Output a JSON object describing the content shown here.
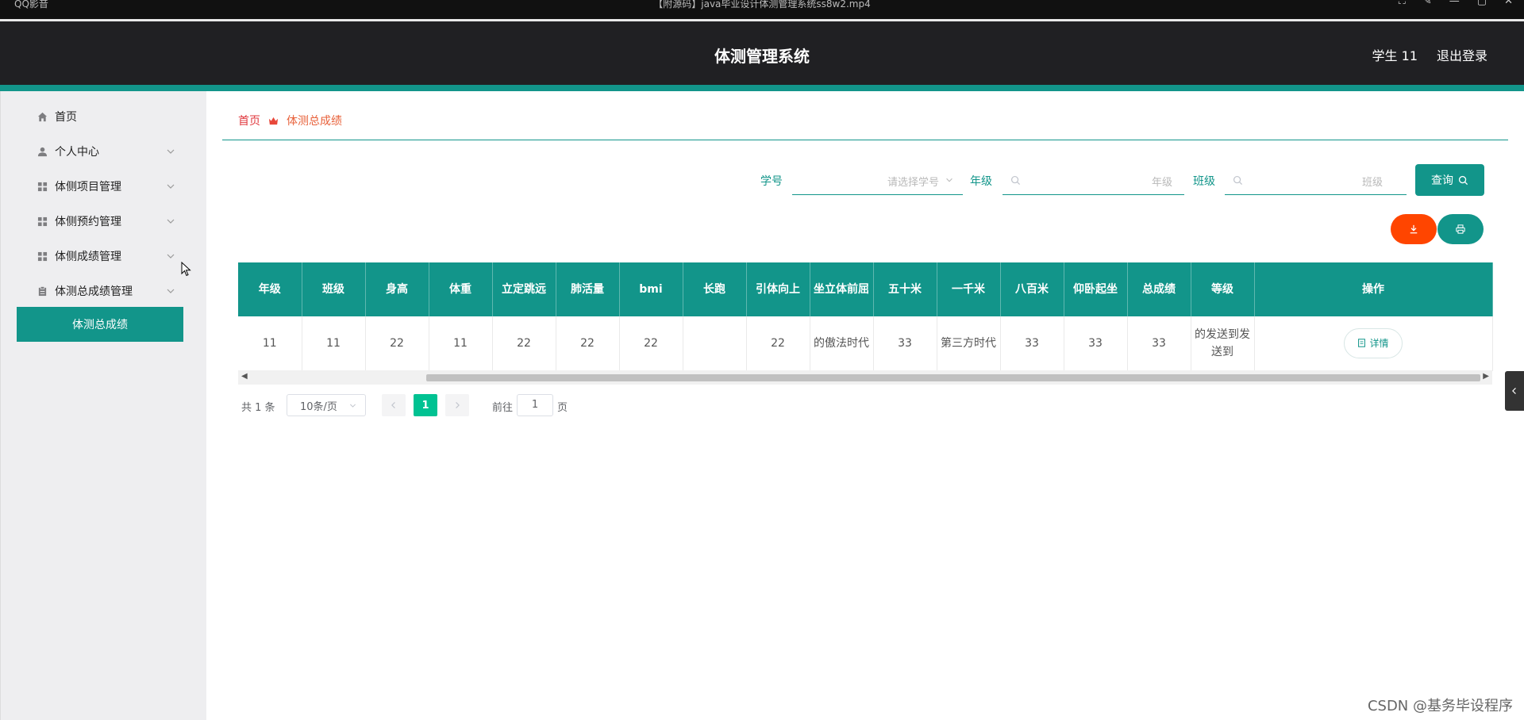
{
  "player": {
    "left_text": "QQ影音",
    "file_name": "【附源码】java毕业设计体测管理系统ss8w2.mp4"
  },
  "header": {
    "title": "体测管理系统",
    "user": "学生 11",
    "logout": "退出登录"
  },
  "sidebar": {
    "items": [
      {
        "label": "首页",
        "icon": "home-icon"
      },
      {
        "label": "个人中心",
        "icon": "user-icon"
      },
      {
        "label": "体侧项目管理",
        "icon": "grid-icon"
      },
      {
        "label": "体侧预约管理",
        "icon": "grid-icon"
      },
      {
        "label": "体侧成绩管理",
        "icon": "grid-icon"
      },
      {
        "label": "体测总成绩管理",
        "icon": "clipboard-icon"
      }
    ],
    "active_sub": "体测总成绩"
  },
  "breadcrumb": {
    "home": "首页",
    "current": "体测总成绩"
  },
  "search": {
    "student_id_label": "学号",
    "student_id_placeholder": "请选择学号",
    "grade_label": "年级",
    "grade_placeholder": "年级",
    "class_label": "班级",
    "class_placeholder": "班级",
    "query_button": "查询"
  },
  "table": {
    "headers": [
      "年级",
      "班级",
      "身高",
      "体重",
      "立定跳远",
      "肺活量",
      "bmi",
      "长跑",
      "引体向上",
      "坐立体前屈",
      "五十米",
      "一千米",
      "八百米",
      "仰卧起坐",
      "总成绩",
      "等级",
      "操作"
    ],
    "rows": [
      [
        "11",
        "11",
        "22",
        "11",
        "22",
        "22",
        "22",
        "",
        "22",
        "的傲法时代",
        "33",
        "第三方时代",
        "33",
        "33",
        "33",
        "的发送到发送到"
      ]
    ],
    "detail_button": "详情"
  },
  "pagination": {
    "total": "共 1 条",
    "page_size": "10条/页",
    "current_page": "1",
    "goto_label": "前往",
    "goto_value": "1",
    "page_word": "页"
  },
  "watermark": "CSDN @基务毕设程序",
  "colors": {
    "primary": "#12958a",
    "export": "#ff4500",
    "page_active": "#00c292"
  }
}
